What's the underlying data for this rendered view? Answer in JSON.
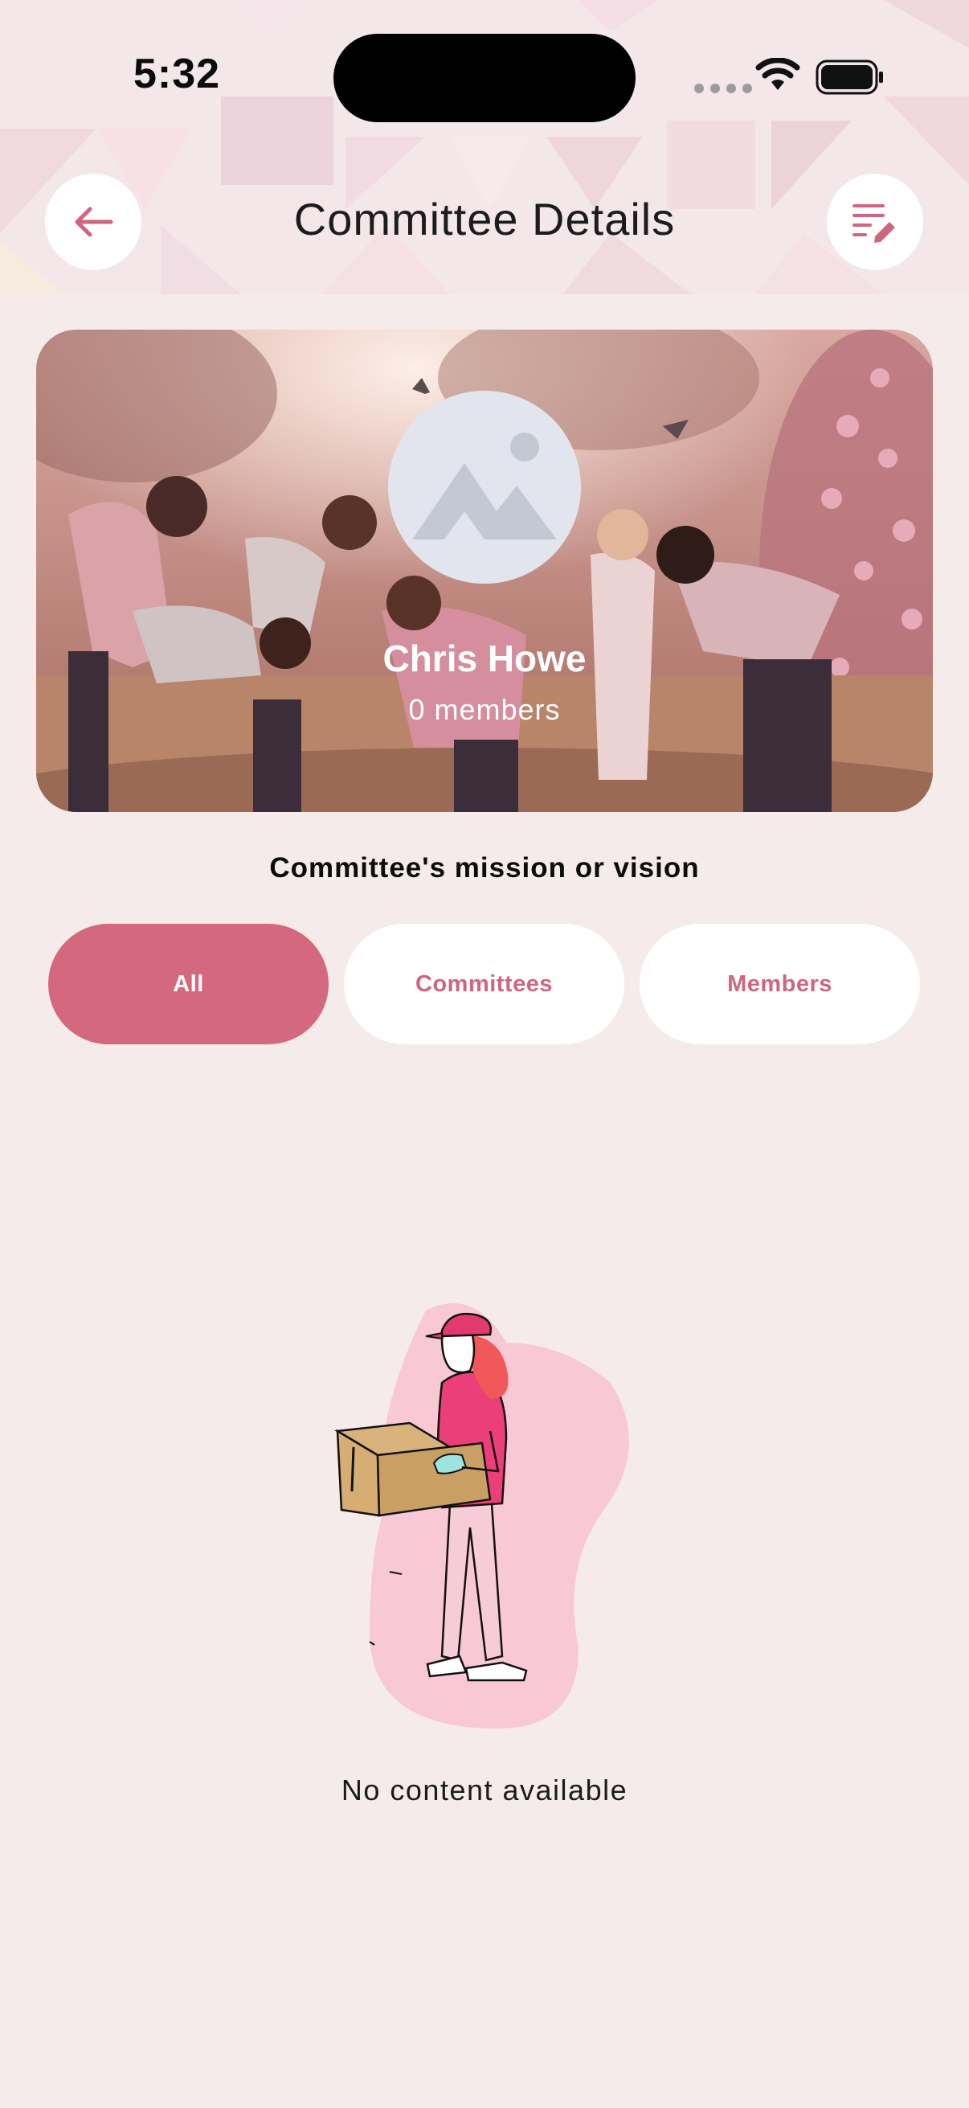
{
  "status_bar": {
    "time": "5:32"
  },
  "header": {
    "title": "Committee Details",
    "back_icon": "arrow-left-icon",
    "edit_icon": "list-edit-icon"
  },
  "hero": {
    "name": "Chris Howe",
    "members": "0 members",
    "avatar_icon": "image-placeholder-icon"
  },
  "mission_label": "Committee's mission or vision",
  "tabs": [
    {
      "label": "All",
      "active": true
    },
    {
      "label": "Committees",
      "active": false
    },
    {
      "label": "Members",
      "active": false
    }
  ],
  "empty_state": {
    "message": "No content available",
    "illustration": "person-holding-box-illustration"
  },
  "colors": {
    "accent": "#d4687e",
    "background": "#f5ebea",
    "tab_inactive_text": "#cf6680"
  }
}
